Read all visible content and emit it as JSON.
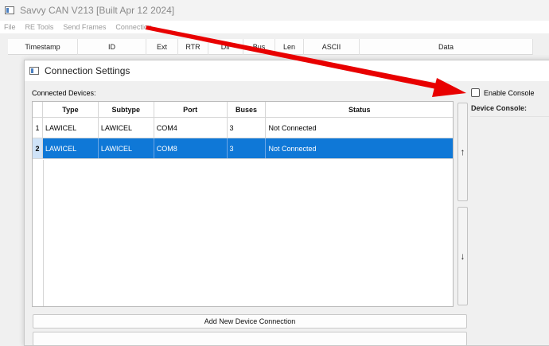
{
  "app": {
    "title": "Savvy CAN V213 [Built Apr 12 2024]"
  },
  "menu": [
    "File",
    "RE Tools",
    "Send Frames",
    "Connection"
  ],
  "frames_table": {
    "columns": [
      "Timestamp",
      "ID",
      "Ext",
      "RTR",
      "Dir",
      "Bus",
      "Len",
      "ASCII",
      "Data"
    ]
  },
  "dialog": {
    "title": "Connection Settings",
    "connected_devices_label": "Connected Devices:",
    "table": {
      "columns": [
        "Type",
        "Subtype",
        "Port",
        "Buses",
        "Status"
      ],
      "rows": [
        {
          "num": "1",
          "type": "LAWICEL",
          "subtype": "LAWICEL",
          "port": "COM4",
          "buses": "3",
          "status": "Not Connected",
          "selected": false
        },
        {
          "num": "2",
          "type": "LAWICEL",
          "subtype": "LAWICEL",
          "port": "COM8",
          "buses": "3",
          "status": "Not Connected",
          "selected": true
        }
      ]
    },
    "move_up_icon": "↑",
    "move_down_icon": "↓",
    "add_button_label": "Add New Device Connection",
    "enable_console_label": "Enable Console",
    "enable_console_checked": false,
    "device_console_label": "Device Console:"
  },
  "colors": {
    "selection": "#0f78d7",
    "annotation_arrow": "#e80000"
  }
}
